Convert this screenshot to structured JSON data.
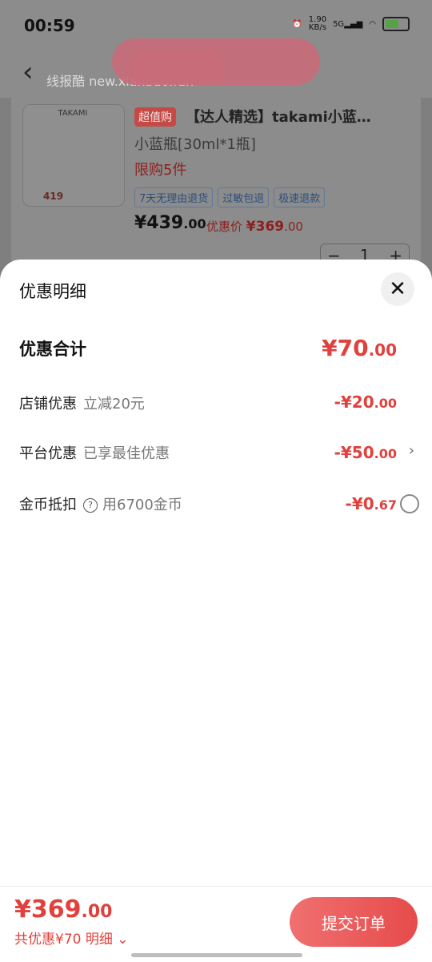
{
  "status": {
    "time": "00:59",
    "net_speed": "1.90",
    "net_unit": "KB/s",
    "network": "5G"
  },
  "topbar": {
    "blurred_text": "线报酷 new.xianbao.fun"
  },
  "product": {
    "thumb_brand": "TAKAMI",
    "thumb_price": "419",
    "badge": "超值购",
    "title": "【达人精选】takami小蓝…",
    "spec": "小蓝瓶[30ml*1瓶]",
    "limit": "限购5件",
    "tags": [
      "7天无理由退货",
      "过敏包退",
      "极速退款"
    ],
    "price_int": "¥439",
    "price_dec": ".00",
    "discount_label": "优惠价 ",
    "discount_int": "¥369",
    "discount_dec": ".00",
    "quantity": "1",
    "minus": "−",
    "plus": "+"
  },
  "sheet": {
    "title": "优惠明细",
    "close_glyph": "✕",
    "total_label": "优惠合计",
    "total_int": "¥70",
    "total_dec": ".00",
    "rows": [
      {
        "label": "店铺优惠",
        "sub": "立减20元",
        "amt_int": "-¥20",
        "amt_dec": ".00"
      },
      {
        "label": "平台优惠",
        "sub": "已享最佳优惠",
        "amt_int": "-¥50",
        "amt_dec": ".00",
        "chevron": "›"
      },
      {
        "label": "金币抵扣",
        "help": "?",
        "sub": "用6700金币",
        "amt_int": "-¥0",
        "amt_dec": ".67"
      }
    ]
  },
  "bottom": {
    "final_int": "¥369",
    "final_dec": ".00",
    "summary": "共优惠¥70 明细",
    "summary_chev": "⌄",
    "submit": "提交订单"
  },
  "colors": {
    "accent": "#e0413d",
    "submit_start": "#f07070",
    "submit_end": "#e64b4b",
    "tag_blue": "#2d4e7c"
  }
}
